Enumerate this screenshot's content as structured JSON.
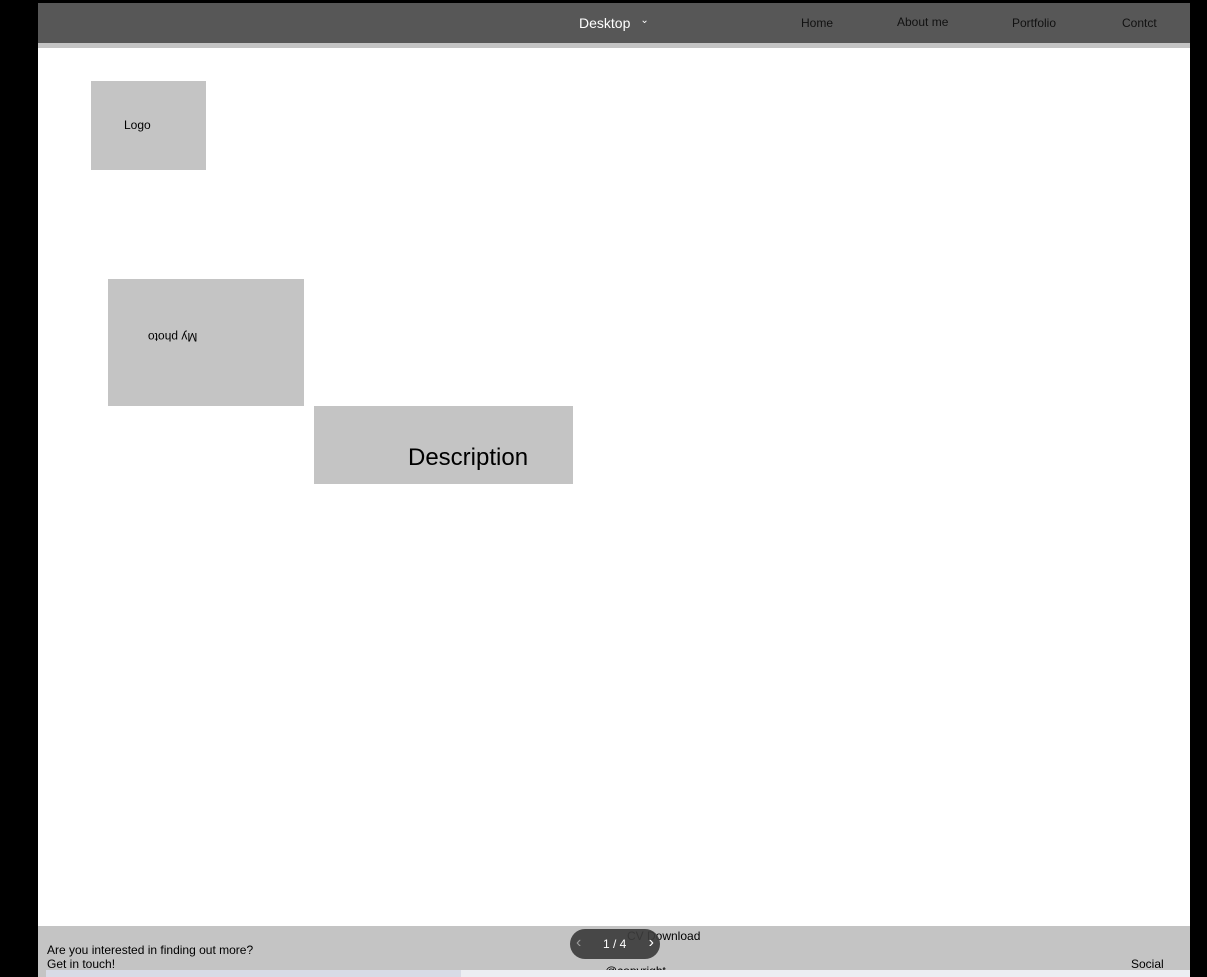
{
  "topbar": {
    "device": "Desktop",
    "nav": [
      "Home",
      "About me",
      "Portfolio",
      "Contct"
    ]
  },
  "content": {
    "logo": "Logo",
    "photo": "My photo",
    "description": "Description"
  },
  "footer": {
    "line1": "Are you interested in finding out more?",
    "line2": "Get in touch!",
    "cv": "CV Download",
    "copyright": "@copyright",
    "social": "Social"
  },
  "pager": {
    "label": "1 / 4"
  },
  "colors": {
    "background": "#000000",
    "topbar": "#575757",
    "placeholder": "#c4c4c4",
    "page": "#ffffff"
  }
}
